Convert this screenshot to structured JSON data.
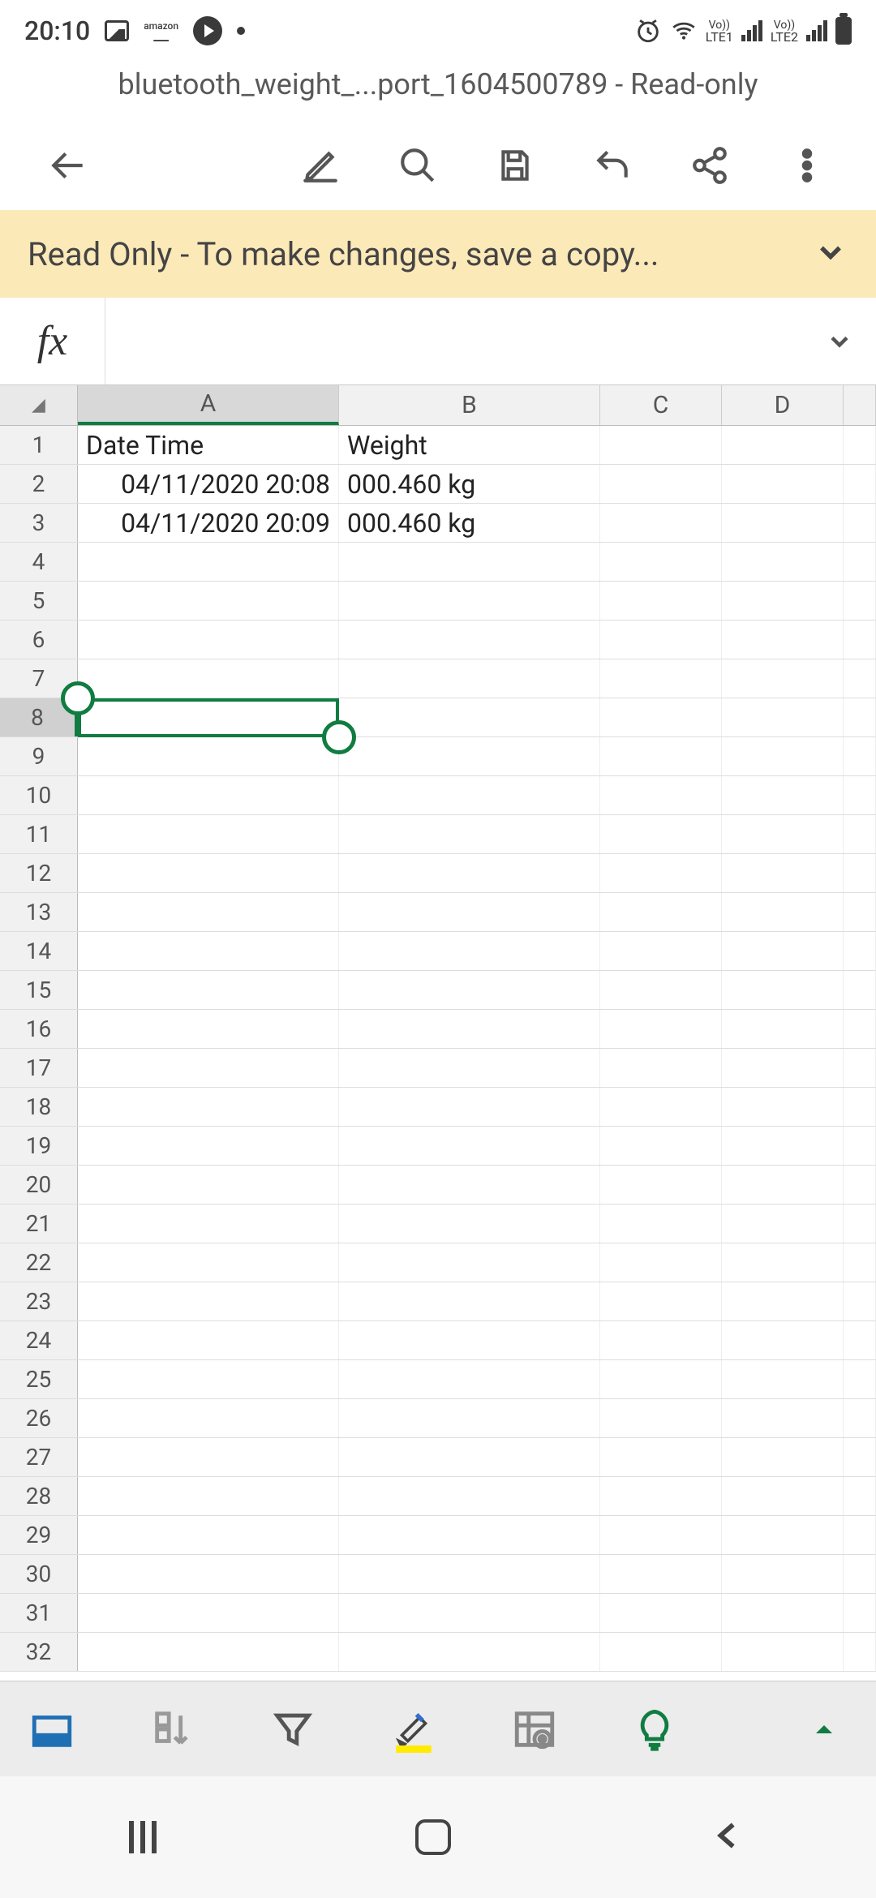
{
  "status": {
    "time": "20:10",
    "lte1": "LTE1",
    "lte2": "LTE2",
    "vo": "Vo))"
  },
  "doc": {
    "title": "bluetooth_weight_...port_1604500789 - Read-only"
  },
  "banner": {
    "text": "Read Only - To make changes, save a copy..."
  },
  "formula": {
    "label": "fx",
    "value": ""
  },
  "columns": [
    "A",
    "B",
    "C",
    "D"
  ],
  "rows": {
    "count": 32,
    "selected": 8,
    "data": {
      "1": {
        "A": "Date Time",
        "B": "Weight"
      },
      "2": {
        "A": "04/11/2020 20:08",
        "B": "000.460 kg",
        "A_align": "right"
      },
      "3": {
        "A": "04/11/2020 20:09",
        "B": "000.460 kg",
        "A_align": "right"
      }
    }
  },
  "selection": {
    "col": "A",
    "row": 8
  }
}
